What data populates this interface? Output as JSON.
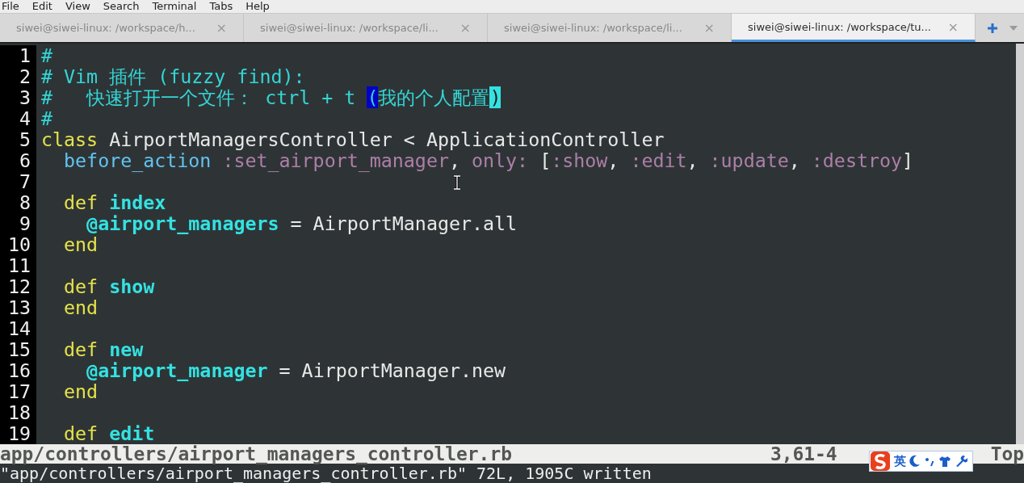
{
  "menu": [
    "File",
    "Edit",
    "View",
    "Search",
    "Terminal",
    "Tabs",
    "Help"
  ],
  "tabs": [
    {
      "label": "siwei@siwei-linux: /workspace/h...",
      "close": "×",
      "selected": false
    },
    {
      "label": "siwei@siwei-linux: /workspace/li...",
      "close": "×",
      "selected": false
    },
    {
      "label": "siwei@siwei-linux: /workspace/li...",
      "close": "×",
      "selected": false
    },
    {
      "label": "siwei@siwei-linux: /workspace/tu...",
      "close": "×",
      "selected": true
    }
  ],
  "editor": {
    "lines": [
      {
        "number": "1",
        "segments": [
          {
            "kind": "comment",
            "text": "#"
          }
        ]
      },
      {
        "number": "2",
        "segments": [
          {
            "kind": "comment",
            "text": "# Vim 插件 (fuzzy find):"
          }
        ]
      },
      {
        "number": "3",
        "segments": [
          {
            "kind": "comment",
            "text": "#   快速打开一个文件： ctrl + t"
          },
          {
            "kind": "match_open",
            "text": "("
          },
          {
            "kind": "comment",
            "text": "我的个人配置"
          },
          {
            "kind": "match_close",
            "text": ")"
          }
        ]
      },
      {
        "number": "4",
        "segments": [
          {
            "kind": "comment",
            "text": "#"
          }
        ]
      },
      {
        "number": "5",
        "segments": [
          {
            "kind": "keyword",
            "text": "class"
          },
          {
            "kind": "text",
            "text": " AirportManagersController < ApplicationController"
          }
        ]
      },
      {
        "number": "6",
        "segments": [
          {
            "kind": "func",
            "text": "  before_action"
          },
          {
            "kind": "symbol",
            "text": " :set_airport_manager"
          },
          {
            "kind": "text",
            "text": ","
          },
          {
            "kind": "symbol",
            "text": " only:"
          },
          {
            "kind": "text",
            "text": " ["
          },
          {
            "kind": "symbol",
            "text": ":show"
          },
          {
            "kind": "text",
            "text": ","
          },
          {
            "kind": "symbol",
            "text": " :edit"
          },
          {
            "kind": "text",
            "text": ","
          },
          {
            "kind": "symbol",
            "text": " :update"
          },
          {
            "kind": "text",
            "text": ","
          },
          {
            "kind": "symbol",
            "text": " :destroy"
          },
          {
            "kind": "text",
            "text": "]"
          }
        ]
      },
      {
        "number": "7"
      },
      {
        "number": "8",
        "segments": [
          {
            "kind": "keyword",
            "text": "  def"
          },
          {
            "kind": "name",
            "text": " index"
          }
        ]
      },
      {
        "number": "9",
        "segments": [
          {
            "kind": "name",
            "text": "    @airport_managers"
          },
          {
            "kind": "text",
            "text": " = AirportManager.all"
          }
        ]
      },
      {
        "number": "10",
        "segments": [
          {
            "kind": "keyword",
            "text": "  end"
          }
        ]
      },
      {
        "number": "11"
      },
      {
        "number": "12",
        "segments": [
          {
            "kind": "keyword",
            "text": "  def"
          },
          {
            "kind": "name",
            "text": " show"
          }
        ]
      },
      {
        "number": "13",
        "segments": [
          {
            "kind": "keyword",
            "text": "  end"
          }
        ]
      },
      {
        "number": "14"
      },
      {
        "number": "15",
        "segments": [
          {
            "kind": "keyword",
            "text": "  def"
          },
          {
            "kind": "name",
            "text": " new"
          }
        ]
      },
      {
        "number": "16",
        "segments": [
          {
            "kind": "name",
            "text": "    @airport_manager"
          },
          {
            "kind": "text",
            "text": " = AirportManager.new"
          }
        ]
      },
      {
        "number": "17",
        "segments": [
          {
            "kind": "keyword",
            "text": "  end"
          }
        ]
      },
      {
        "number": "18"
      },
      {
        "number": "19",
        "segments": [
          {
            "kind": "keyword",
            "text": "  def"
          },
          {
            "kind": "name",
            "text": " edit"
          }
        ]
      }
    ]
  },
  "status_line": {
    "file": "app/controllers/airport_managers_controller.rb",
    "position": "3,61-4",
    "scroll": "Top"
  },
  "ime_toolbar": {
    "mode": "英"
  },
  "message": "\"app/controllers/airport_managers_controller.rb\" 72L, 1905C written"
}
